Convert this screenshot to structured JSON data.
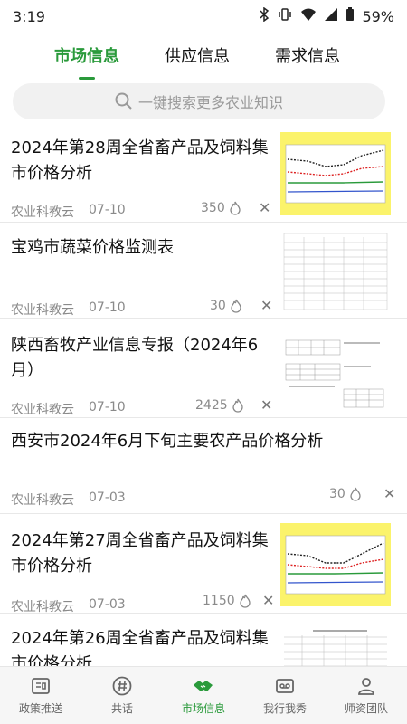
{
  "status": {
    "time": "3:19",
    "battery": "59%"
  },
  "tabs": [
    {
      "label": "市场信息",
      "active": true
    },
    {
      "label": "供应信息",
      "active": false
    },
    {
      "label": "需求信息",
      "active": false
    }
  ],
  "search": {
    "placeholder": "一键搜索更多农业知识"
  },
  "feed": [
    {
      "title": "2024年第28周全省畜产品及饲料集市价格分析",
      "source": "农业科教云",
      "date": "07-10",
      "hot": "350"
    },
    {
      "title": "宝鸡市蔬菜价格监测表",
      "source": "农业科教云",
      "date": "07-10",
      "hot": "30"
    },
    {
      "title": "陕西畜牧产业信息专报（2024年6月）",
      "source": "农业科教云",
      "date": "07-10",
      "hot": "2425"
    },
    {
      "title": "西安市2024年6月下旬主要农产品价格分析",
      "source": "农业科教云",
      "date": "07-03",
      "hot": "30"
    },
    {
      "title": "2024年第27周全省畜产品及饲料集市价格分析",
      "source": "农业科教云",
      "date": "07-03",
      "hot": "1150"
    },
    {
      "title": "2024年第26周全省畜产品及饲料集市价格分析",
      "source": "",
      "date": "",
      "hot": ""
    }
  ],
  "nav": [
    {
      "label": "政策推送",
      "icon": "policy-icon",
      "active": false
    },
    {
      "label": "共话",
      "icon": "hashtag-icon",
      "active": false
    },
    {
      "label": "市场信息",
      "icon": "handshake-icon",
      "active": true
    },
    {
      "label": "我行我秀",
      "icon": "show-icon",
      "active": false
    },
    {
      "label": "师资团队",
      "icon": "team-icon",
      "active": false
    }
  ],
  "colors": {
    "accent": "#2a9a3b",
    "thumb_bg": "#fbf36b"
  }
}
